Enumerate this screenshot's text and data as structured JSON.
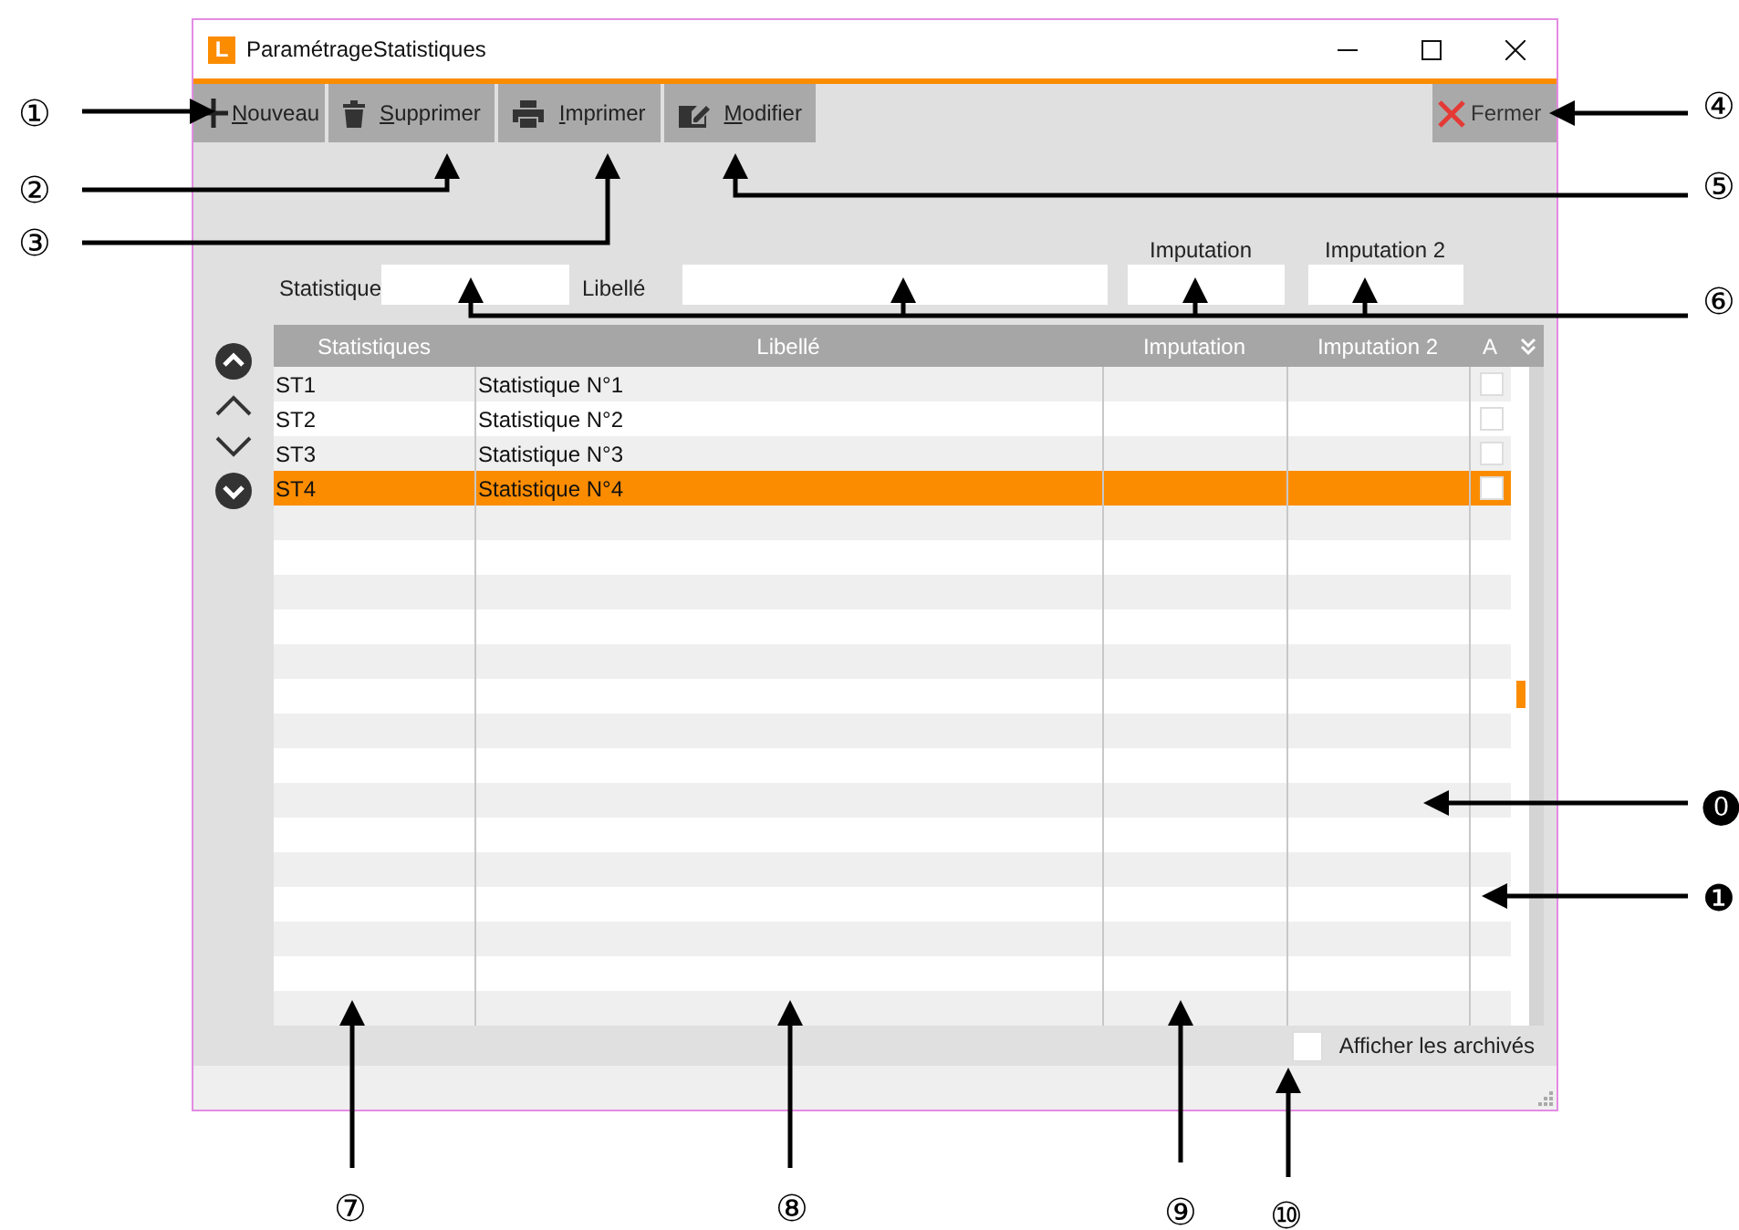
{
  "window": {
    "logo": "L",
    "title": "ParamétrageStatistiques"
  },
  "toolbar": [
    {
      "kind": "new",
      "label": "Nouveau",
      "mnemonic": true
    },
    {
      "kind": "delete",
      "label": "Supprimer",
      "mnemonic": true
    },
    {
      "kind": "print",
      "label": "Imprimer",
      "mnemonic": true
    },
    {
      "kind": "edit",
      "label": "Modifier",
      "mnemonic": true
    }
  ],
  "close_button": {
    "label": "Fermer"
  },
  "filters": [
    {
      "label": "Statistique"
    },
    {
      "label": "Libellé"
    },
    {
      "label": "Imputation"
    },
    {
      "label": "Imputation 2"
    }
  ],
  "table": {
    "columns": [
      "Statistiques",
      "Libellé",
      "Imputation",
      "Imputation 2",
      "A"
    ],
    "rows": [
      {
        "code": "ST1",
        "label": "Statistique N°1",
        "archived": false,
        "selected": false
      },
      {
        "code": "ST2",
        "label": "Statistique N°2",
        "archived": false,
        "selected": false
      },
      {
        "code": "ST3",
        "label": "Statistique N°3",
        "archived": false,
        "selected": false
      },
      {
        "code": "ST4",
        "label": "Statistique N°4",
        "archived": false,
        "selected": true
      }
    ]
  },
  "show_archived": {
    "label": "Afficher les archivés",
    "checked": false
  },
  "callouts": [
    "①",
    "②",
    "③",
    "④",
    "⑤",
    "⑥",
    "⑦",
    "⑧",
    "⑨",
    "⑩",
    "⓿",
    "❶"
  ]
}
